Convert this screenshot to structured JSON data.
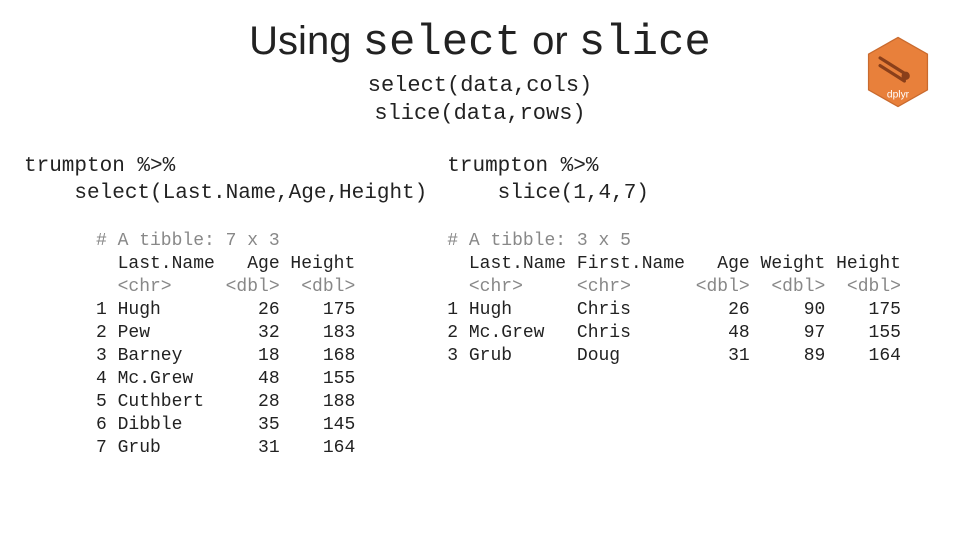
{
  "title_pre": "Using ",
  "title_kw1": "select",
  "title_mid": " or ",
  "title_kw2": "slice",
  "subtitle_line1": "select(data,cols)",
  "subtitle_line2": "slice(data,rows)",
  "logo_label": "dplyr",
  "left": {
    "cmd_line1": "trumpton %>%",
    "cmd_line2": "    select(Last.Name,Age,Height)",
    "tibble_header": "# A tibble: 7 x 3",
    "col_headers": "  Last.Name   Age Height",
    "col_types": "  <chr>     <dbl>  <dbl>",
    "rows": [
      "1 Hugh         26    175",
      "2 Pew          32    183",
      "3 Barney       18    168",
      "4 Mc.Grew      48    155",
      "5 Cuthbert     28    188",
      "6 Dibble       35    145",
      "7 Grub         31    164"
    ]
  },
  "right": {
    "cmd_line1": "trumpton %>%",
    "cmd_line2": "    slice(1,4,7)",
    "tibble_header": "# A tibble: 3 x 5",
    "col_headers": "  Last.Name First.Name   Age Weight Height",
    "col_types": "  <chr>     <chr>      <dbl>  <dbl>  <dbl>",
    "rows": [
      "1 Hugh      Chris         26     90    175",
      "2 Mc.Grew   Chris         48     97    155",
      "3 Grub      Doug          31     89    164"
    ]
  },
  "chart_data": [
    {
      "type": "table",
      "title": "select(Last.Name,Age,Height)",
      "columns": [
        "Last.Name",
        "Age",
        "Height"
      ],
      "col_types": [
        "<chr>",
        "<dbl>",
        "<dbl>"
      ],
      "rows": [
        [
          "Hugh",
          26,
          175
        ],
        [
          "Pew",
          32,
          183
        ],
        [
          "Barney",
          18,
          168
        ],
        [
          "Mc.Grew",
          48,
          155
        ],
        [
          "Cuthbert",
          28,
          188
        ],
        [
          "Dibble",
          35,
          145
        ],
        [
          "Grub",
          31,
          164
        ]
      ]
    },
    {
      "type": "table",
      "title": "slice(1,4,7)",
      "columns": [
        "Last.Name",
        "First.Name",
        "Age",
        "Weight",
        "Height"
      ],
      "col_types": [
        "<chr>",
        "<chr>",
        "<dbl>",
        "<dbl>",
        "<dbl>"
      ],
      "rows": [
        [
          "Hugh",
          "Chris",
          26,
          90,
          175
        ],
        [
          "Mc.Grew",
          "Chris",
          48,
          97,
          155
        ],
        [
          "Grub",
          "Doug",
          31,
          89,
          164
        ]
      ]
    }
  ]
}
